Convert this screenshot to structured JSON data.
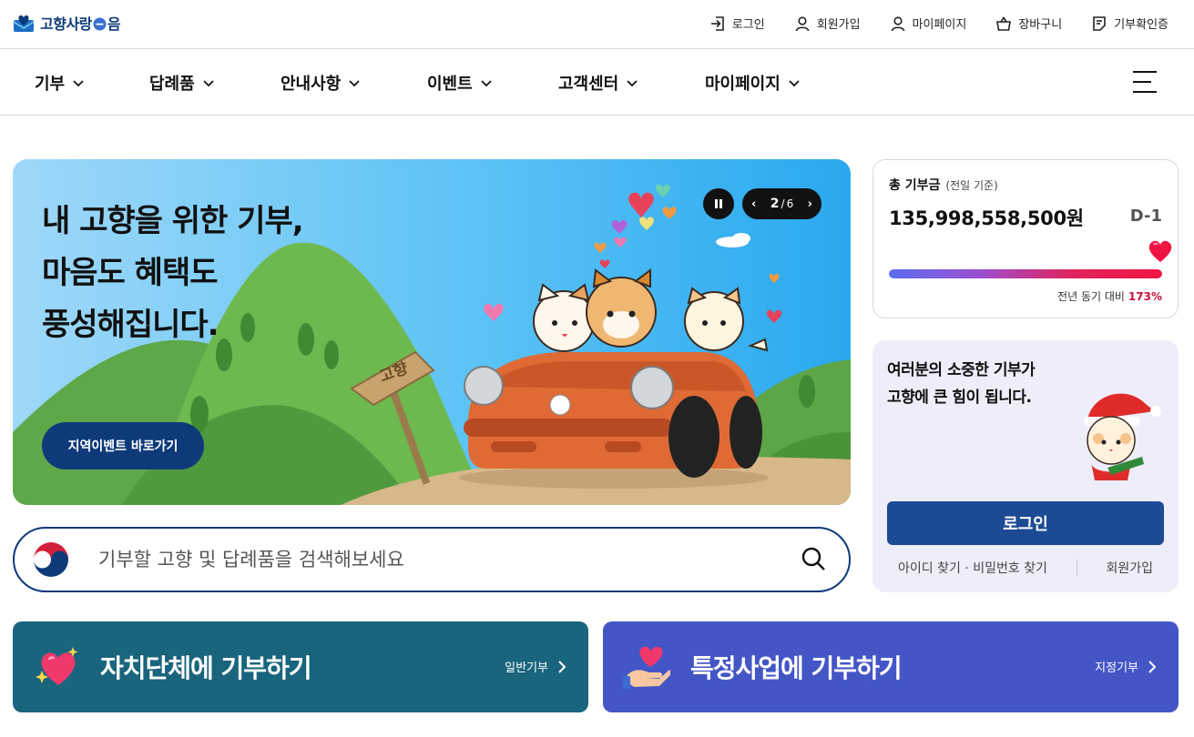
{
  "logo": {
    "text_before": "고향사랑",
    "text_after": "음",
    "emblem_icon": "heart-mailbox-icon"
  },
  "utility_links": [
    {
      "label": "로그인",
      "icon": "login-icon"
    },
    {
      "label": "회원가입",
      "icon": "person-icon"
    },
    {
      "label": "마이페이지",
      "icon": "person-icon"
    },
    {
      "label": "장바구니",
      "icon": "basket-icon"
    },
    {
      "label": "기부확인증",
      "icon": "certificate-icon"
    }
  ],
  "nav": [
    {
      "label": "기부"
    },
    {
      "label": "답례품"
    },
    {
      "label": "안내사항"
    },
    {
      "label": "이벤트"
    },
    {
      "label": "고객센터"
    },
    {
      "label": "마이페이지"
    }
  ],
  "hero": {
    "title_lines": [
      "내 고향을 위한 기부,",
      "마음도 혜택도",
      "풍성해집니다."
    ],
    "button_label": "지역이벤트 바로가기",
    "signpost_text": "고향",
    "slide_current": "2",
    "slide_separator": "/",
    "slide_total": "6",
    "prev_symbol": "‹",
    "next_symbol": "›"
  },
  "search": {
    "placeholder": "기부할 고향 및 답례품을 검색해보세요"
  },
  "total_donation": {
    "label": "총 기부금",
    "sublabel": "(전일 기준)",
    "amount": "135,998,558,500원",
    "dday": "D-1",
    "compare_label": "전년 동기 대비",
    "compare_pct": "173%",
    "progress_fraction": 1.0
  },
  "login_card": {
    "message_lines": [
      "여러분의 소중한 기부가",
      "고향에 큰 힘이 됩니다."
    ],
    "login_button": "로그인",
    "find_links": "아이디 찾기 · 비밀번호 찾기",
    "signup_link": "회원가입"
  },
  "cta": [
    {
      "title": "자치단체에 기부하기",
      "sub": "일반기부",
      "icon": "sparkle-heart-icon",
      "color": "#19657d"
    },
    {
      "title": "특정사업에 기부하기",
      "sub": "지정기부",
      "icon": "hand-heart-icon",
      "color": "#4456c6"
    }
  ],
  "colors": {
    "navy": "#0e3a7a",
    "login_blue": "#1d4a94",
    "accent_red": "#d0103a"
  }
}
